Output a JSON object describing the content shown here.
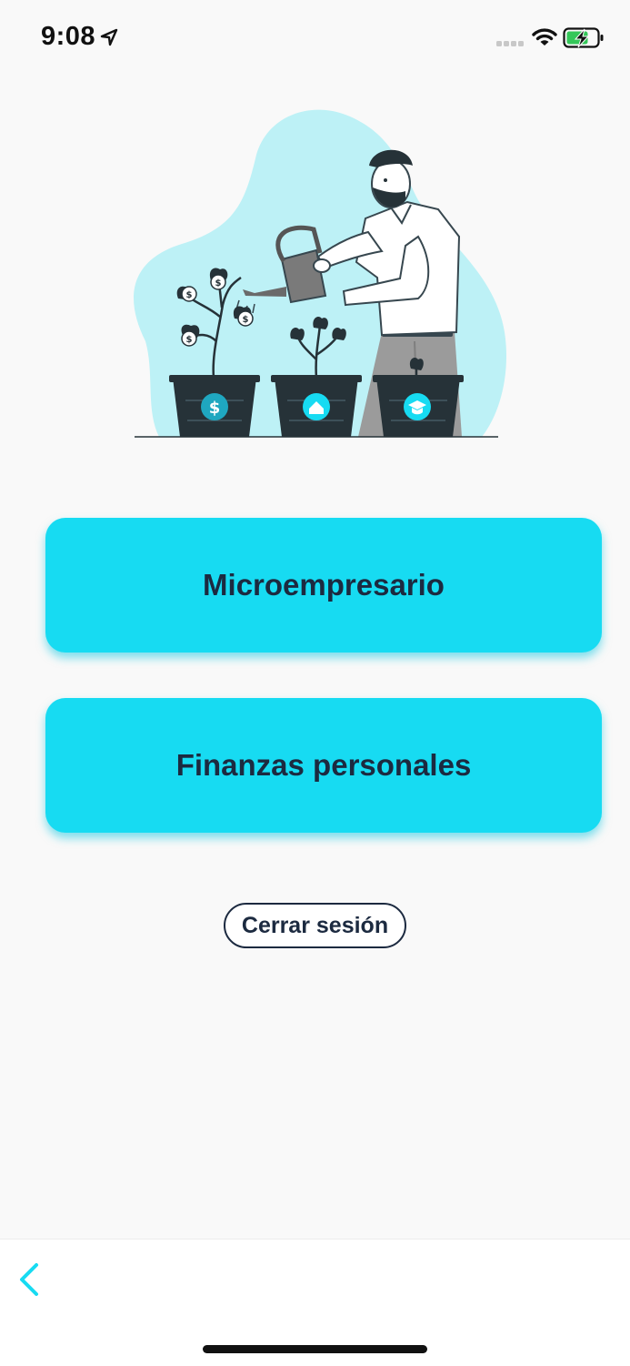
{
  "status_bar": {
    "time": "9:08",
    "icons": [
      "location-arrow-icon",
      "cellular-signal-icon",
      "wifi-icon",
      "battery-charging-icon"
    ]
  },
  "illustration": {
    "subject": "man-watering-plant-pots-icon",
    "pot_icons": [
      "dollar-icon",
      "house-icon",
      "graduation-cap-icon"
    ]
  },
  "menu": {
    "options": [
      {
        "label": "Microempresario"
      },
      {
        "label": "Finanzas personales"
      }
    ],
    "logout_label": "Cerrar sesión"
  },
  "bottom_bar": {
    "back_icon": "chevron-left-icon"
  },
  "colors": {
    "accent": "#17dbf2",
    "text_dark": "#1c2a40",
    "background": "#f9f9f9",
    "blob": "#bdf1f6",
    "pot": "#263238",
    "battery_green": "#34c759"
  }
}
